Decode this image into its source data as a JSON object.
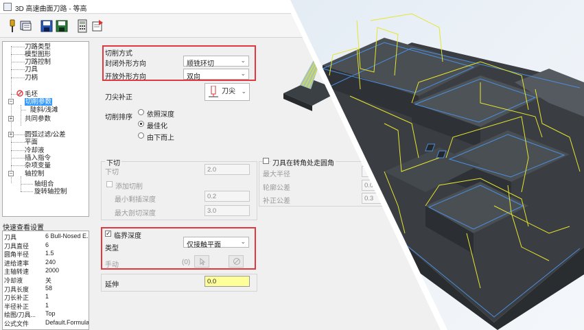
{
  "window": {
    "title": "3D 高速曲面刀路 - 等高"
  },
  "toolbar": {
    "icons": [
      "pin-icon",
      "view-icon",
      "save-icon",
      "save-all-icon",
      "calculator-icon",
      "export-icon"
    ]
  },
  "tree": {
    "items": [
      "刀路类型",
      "模型图形",
      "刀路控制",
      "刀具",
      "刀柄",
      "毛坯",
      "切削参数",
      "陡斜/浅滩",
      "共同参数",
      "圆弧过滤/公差",
      "平面",
      "冷却液",
      "插入指令",
      "杂项变量",
      "轴控制",
      "轴组合",
      "旋转轴控制"
    ]
  },
  "quick_view": {
    "title": "快速查看设置",
    "rows": [
      {
        "k": "刀具",
        "v": "6 Bull-Nosed E..."
      },
      {
        "k": "刀具直径",
        "v": "6"
      },
      {
        "k": "圆角半径",
        "v": "1.5"
      },
      {
        "k": "进给速率",
        "v": "240"
      },
      {
        "k": "主轴转速",
        "v": "2000"
      },
      {
        "k": "冷却液",
        "v": "关"
      },
      {
        "k": "刀具长度",
        "v": "58"
      },
      {
        "k": "刀长补正",
        "v": "1"
      },
      {
        "k": "半径补正",
        "v": "1"
      },
      {
        "k": "绘图/刀具...",
        "v": "Top"
      },
      {
        "k": "公式文件",
        "v": "Default.Formula"
      }
    ]
  },
  "cut_method": {
    "title": "切削方式",
    "closed_label": "封闭外形方向",
    "closed_value": "顺铣环切",
    "open_label": "开放外形方向",
    "open_value": "双向"
  },
  "compensation": {
    "label": "刀尖补正",
    "value": "刀尖"
  },
  "cut_order": {
    "label": "切削排序",
    "options": [
      "依照深度",
      "最佳化",
      "由下而上"
    ],
    "selected": 1
  },
  "down_cut": {
    "title": "下切",
    "down_label": "下切",
    "down_value": "2.0",
    "add_label": "添加切削",
    "min_label": "最小剩插深度",
    "min_value": "0.2",
    "max_label": "最大剖切深度",
    "max_value": "3.0"
  },
  "corner": {
    "label": "刀具在转角处走圆角",
    "max_radius": "最大半径",
    "profile_tol": "轮廓公差",
    "offset_tol": "补正公差",
    "profile_val": "0.0",
    "offset_val": "0.3"
  },
  "critical": {
    "label": "临界深度",
    "type_label": "类型",
    "type_value": "仅接触平面",
    "manual_label": "手动",
    "manual_count": "(0)"
  },
  "extend": {
    "label": "延伸",
    "value": "0.0"
  },
  "colors": {
    "red": "#e0383e",
    "select": "#3399ff",
    "yellow": "#ffff99",
    "model": "#3a3e42",
    "toolpath": "#e6e62e",
    "toolpath_blue": "#4b8fe0"
  }
}
